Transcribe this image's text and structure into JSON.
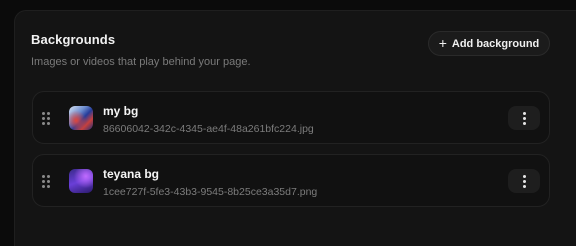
{
  "section": {
    "title": "Backgrounds",
    "subtitle": "Images or videos that play behind your page.",
    "add_button": "Add background",
    "add_icon": "+"
  },
  "backgrounds": [
    {
      "name": "my bg",
      "file": "86606042-342c-4345-ae4f-48a261bfc224.jpg",
      "thumbnail_colors": [
        "#d9e3f2",
        "#253c9a",
        "#c7403d"
      ]
    },
    {
      "name": "teyana bg",
      "file": "1cee727f-5fe3-43b3-9545-8b25ce3a35d7.png",
      "thumbnail_colors": [
        "#3a2a8a",
        "#6a3fd8",
        "#c06bff"
      ]
    }
  ],
  "icons": {
    "drag": "drag-handle-icon",
    "more": "more-vertical-icon",
    "add": "plus-icon"
  }
}
